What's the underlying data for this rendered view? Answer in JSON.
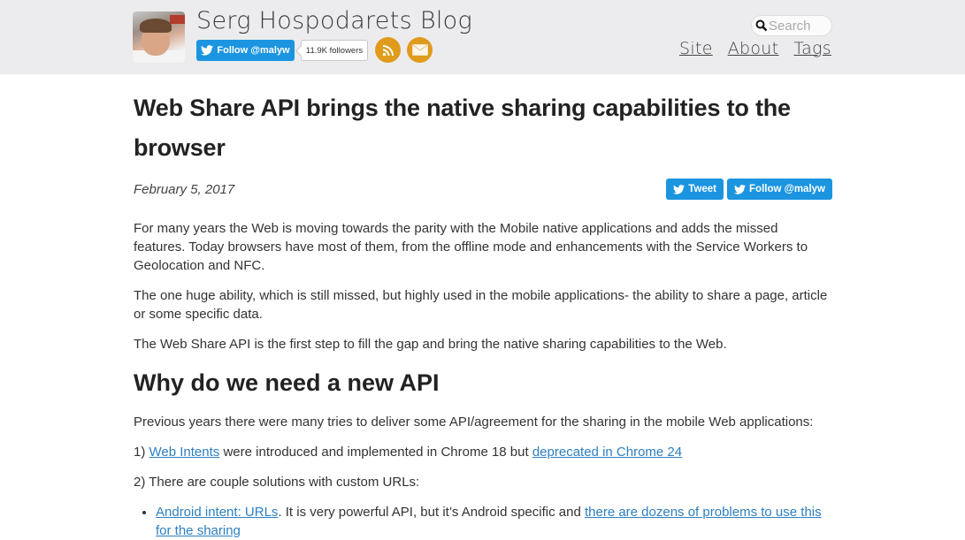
{
  "header": {
    "blog_title": "Serg Hospodarets Blog",
    "follow_button": "Follow @malyw",
    "followers_count": "11.9K followers",
    "rss_icon": "rss-icon",
    "mail_icon": "mail-icon",
    "search": {
      "placeholder": "Search",
      "value": ""
    },
    "nav": [
      {
        "label": "Site"
      },
      {
        "label": "About"
      },
      {
        "label": "Tags"
      }
    ],
    "colors": {
      "twitter": "#1b95e0",
      "rss": "#e09b1d",
      "background": "#ececee"
    }
  },
  "post": {
    "title": "Web Share API brings the native sharing capabilities to the browser",
    "date": "February 5, 2017",
    "share": {
      "tweet": "Tweet",
      "follow": "Follow @malyw"
    },
    "paragraphs": [
      "For many years the Web is moving towards the parity with the Mobile native applications and adds the missed features. Today browsers have most of them, from the offline mode and enhancements with the Service Workers to Geolocation and NFC.",
      "The one huge ability, which is still missed, but highly used in the mobile applications- the ability to share a page, article or some specific data.",
      "The Web Share API is the first step to fill the gap and bring the native sharing capabilities to the Web."
    ],
    "section_heading": "Why do we need a new API",
    "section_intro": "Previous years there were many tries to deliver some API/agreement for the sharing in the mobile Web applications:",
    "item1": {
      "prefix": "1) ",
      "link1": "Web Intents",
      "middle": " were introduced and implemented in Chrome 18 but ",
      "link2": "deprecated in Chrome 24"
    },
    "item2": "2) There are couple solutions with custom URLs:",
    "bullets": [
      {
        "link1": "Android intent: URLs",
        "middle": ". It is very powerful API, but it’s Android specific and ",
        "link2": "there are dozens of problems to use this for the sharing"
      }
    ]
  }
}
